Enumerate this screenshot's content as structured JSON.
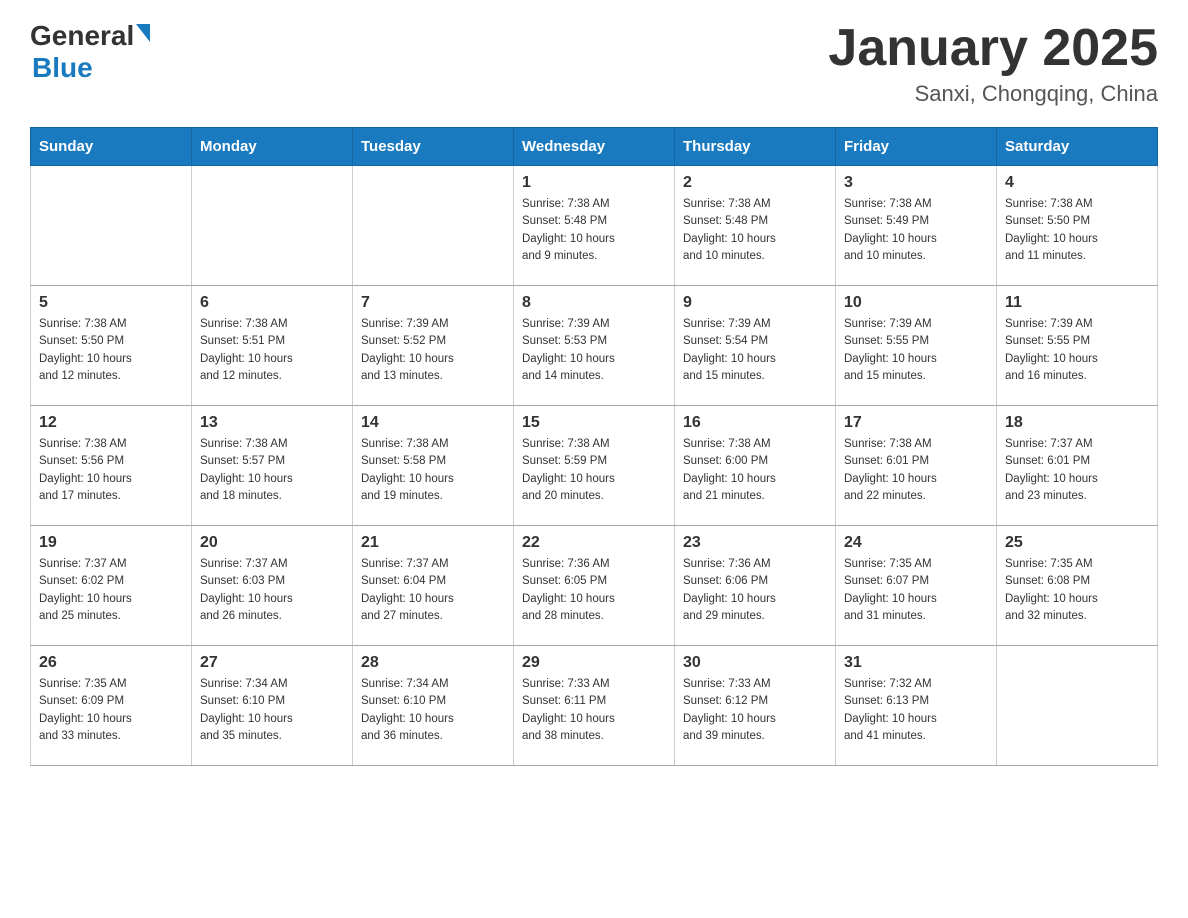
{
  "header": {
    "logo_general": "General",
    "logo_blue": "Blue",
    "month_title": "January 2025",
    "subtitle": "Sanxi, Chongqing, China"
  },
  "days_of_week": [
    "Sunday",
    "Monday",
    "Tuesday",
    "Wednesday",
    "Thursday",
    "Friday",
    "Saturday"
  ],
  "weeks": [
    [
      {
        "day": "",
        "info": ""
      },
      {
        "day": "",
        "info": ""
      },
      {
        "day": "",
        "info": ""
      },
      {
        "day": "1",
        "info": "Sunrise: 7:38 AM\nSunset: 5:48 PM\nDaylight: 10 hours\nand 9 minutes."
      },
      {
        "day": "2",
        "info": "Sunrise: 7:38 AM\nSunset: 5:48 PM\nDaylight: 10 hours\nand 10 minutes."
      },
      {
        "day": "3",
        "info": "Sunrise: 7:38 AM\nSunset: 5:49 PM\nDaylight: 10 hours\nand 10 minutes."
      },
      {
        "day": "4",
        "info": "Sunrise: 7:38 AM\nSunset: 5:50 PM\nDaylight: 10 hours\nand 11 minutes."
      }
    ],
    [
      {
        "day": "5",
        "info": "Sunrise: 7:38 AM\nSunset: 5:50 PM\nDaylight: 10 hours\nand 12 minutes."
      },
      {
        "day": "6",
        "info": "Sunrise: 7:38 AM\nSunset: 5:51 PM\nDaylight: 10 hours\nand 12 minutes."
      },
      {
        "day": "7",
        "info": "Sunrise: 7:39 AM\nSunset: 5:52 PM\nDaylight: 10 hours\nand 13 minutes."
      },
      {
        "day": "8",
        "info": "Sunrise: 7:39 AM\nSunset: 5:53 PM\nDaylight: 10 hours\nand 14 minutes."
      },
      {
        "day": "9",
        "info": "Sunrise: 7:39 AM\nSunset: 5:54 PM\nDaylight: 10 hours\nand 15 minutes."
      },
      {
        "day": "10",
        "info": "Sunrise: 7:39 AM\nSunset: 5:55 PM\nDaylight: 10 hours\nand 15 minutes."
      },
      {
        "day": "11",
        "info": "Sunrise: 7:39 AM\nSunset: 5:55 PM\nDaylight: 10 hours\nand 16 minutes."
      }
    ],
    [
      {
        "day": "12",
        "info": "Sunrise: 7:38 AM\nSunset: 5:56 PM\nDaylight: 10 hours\nand 17 minutes."
      },
      {
        "day": "13",
        "info": "Sunrise: 7:38 AM\nSunset: 5:57 PM\nDaylight: 10 hours\nand 18 minutes."
      },
      {
        "day": "14",
        "info": "Sunrise: 7:38 AM\nSunset: 5:58 PM\nDaylight: 10 hours\nand 19 minutes."
      },
      {
        "day": "15",
        "info": "Sunrise: 7:38 AM\nSunset: 5:59 PM\nDaylight: 10 hours\nand 20 minutes."
      },
      {
        "day": "16",
        "info": "Sunrise: 7:38 AM\nSunset: 6:00 PM\nDaylight: 10 hours\nand 21 minutes."
      },
      {
        "day": "17",
        "info": "Sunrise: 7:38 AM\nSunset: 6:01 PM\nDaylight: 10 hours\nand 22 minutes."
      },
      {
        "day": "18",
        "info": "Sunrise: 7:37 AM\nSunset: 6:01 PM\nDaylight: 10 hours\nand 23 minutes."
      }
    ],
    [
      {
        "day": "19",
        "info": "Sunrise: 7:37 AM\nSunset: 6:02 PM\nDaylight: 10 hours\nand 25 minutes."
      },
      {
        "day": "20",
        "info": "Sunrise: 7:37 AM\nSunset: 6:03 PM\nDaylight: 10 hours\nand 26 minutes."
      },
      {
        "day": "21",
        "info": "Sunrise: 7:37 AM\nSunset: 6:04 PM\nDaylight: 10 hours\nand 27 minutes."
      },
      {
        "day": "22",
        "info": "Sunrise: 7:36 AM\nSunset: 6:05 PM\nDaylight: 10 hours\nand 28 minutes."
      },
      {
        "day": "23",
        "info": "Sunrise: 7:36 AM\nSunset: 6:06 PM\nDaylight: 10 hours\nand 29 minutes."
      },
      {
        "day": "24",
        "info": "Sunrise: 7:35 AM\nSunset: 6:07 PM\nDaylight: 10 hours\nand 31 minutes."
      },
      {
        "day": "25",
        "info": "Sunrise: 7:35 AM\nSunset: 6:08 PM\nDaylight: 10 hours\nand 32 minutes."
      }
    ],
    [
      {
        "day": "26",
        "info": "Sunrise: 7:35 AM\nSunset: 6:09 PM\nDaylight: 10 hours\nand 33 minutes."
      },
      {
        "day": "27",
        "info": "Sunrise: 7:34 AM\nSunset: 6:10 PM\nDaylight: 10 hours\nand 35 minutes."
      },
      {
        "day": "28",
        "info": "Sunrise: 7:34 AM\nSunset: 6:10 PM\nDaylight: 10 hours\nand 36 minutes."
      },
      {
        "day": "29",
        "info": "Sunrise: 7:33 AM\nSunset: 6:11 PM\nDaylight: 10 hours\nand 38 minutes."
      },
      {
        "day": "30",
        "info": "Sunrise: 7:33 AM\nSunset: 6:12 PM\nDaylight: 10 hours\nand 39 minutes."
      },
      {
        "day": "31",
        "info": "Sunrise: 7:32 AM\nSunset: 6:13 PM\nDaylight: 10 hours\nand 41 minutes."
      },
      {
        "day": "",
        "info": ""
      }
    ]
  ]
}
